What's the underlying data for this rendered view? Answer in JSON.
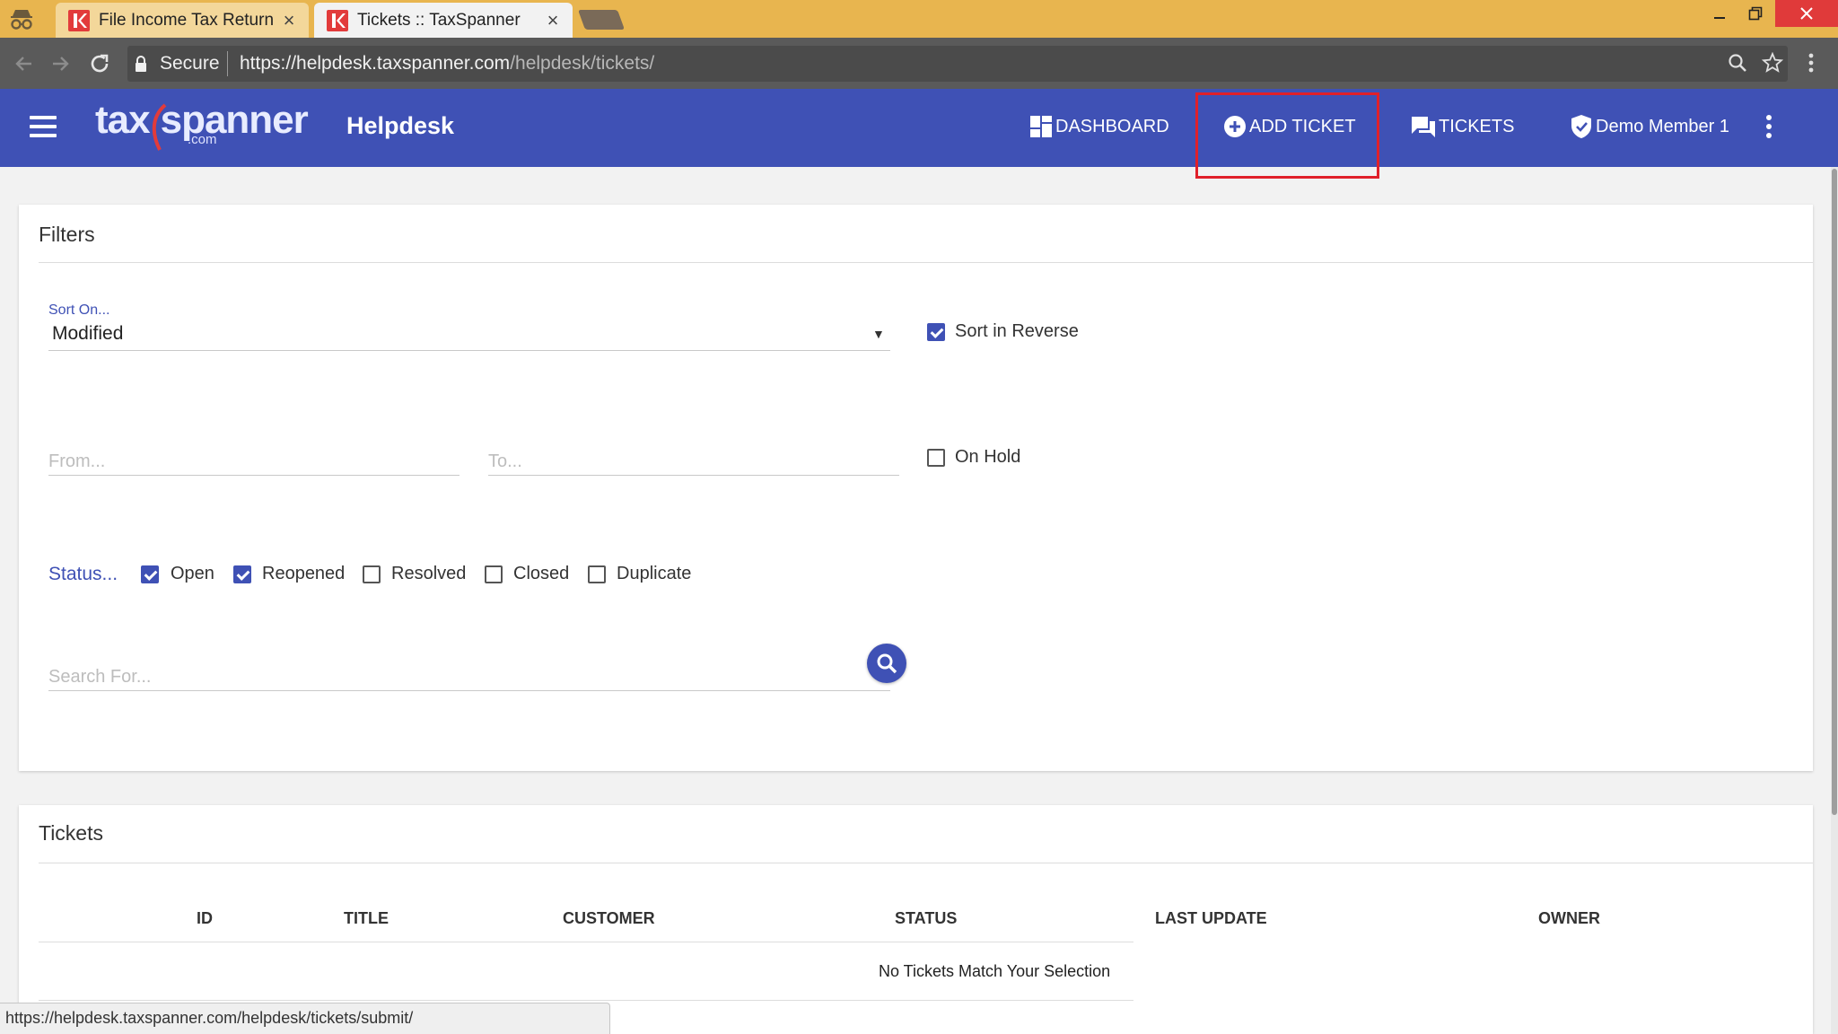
{
  "browser": {
    "tabs": [
      {
        "title": "File Income Tax Return C",
        "close": "×",
        "active": false
      },
      {
        "title": "Tickets :: TaxSpanner",
        "close": "×",
        "active": true
      }
    ],
    "address": {
      "secure_label": "Secure",
      "url_host": "https://helpdesk.taxspanner.com",
      "url_path": "/helpdesk/tickets/"
    },
    "status_url": "https://helpdesk.taxspanner.com/helpdesk/tickets/submit/"
  },
  "header": {
    "logo_text_left": "tax",
    "logo_text_right": "spanner",
    "logo_suffix": ".com",
    "app_title": "Helpdesk",
    "nav": {
      "dashboard": "DASHBOARD",
      "add_ticket": "ADD TICKET",
      "tickets": "TICKETS",
      "user": "Demo Member 1"
    }
  },
  "filters": {
    "title": "Filters",
    "sort_label": "Sort On...",
    "sort_value": "Modified",
    "sort_reverse_label": "Sort in Reverse",
    "sort_reverse_checked": true,
    "from_placeholder": "From...",
    "to_placeholder": "To...",
    "on_hold_label": "On Hold",
    "on_hold_checked": false,
    "status_label": "Status...",
    "statuses": [
      {
        "label": "Open",
        "checked": true
      },
      {
        "label": "Reopened",
        "checked": true
      },
      {
        "label": "Resolved",
        "checked": false
      },
      {
        "label": "Closed",
        "checked": false
      },
      {
        "label": "Duplicate",
        "checked": false
      }
    ],
    "search_placeholder": "Search For..."
  },
  "tickets": {
    "title": "Tickets",
    "columns": [
      "ID",
      "TITLE",
      "CUSTOMER",
      "STATUS",
      "LAST UPDATE",
      "OWNER"
    ],
    "empty_message": "No Tickets Match Your Selection"
  },
  "colors": {
    "primary": "#3f51b5",
    "tab_bar": "#e8b54f",
    "highlight": "#e0202a"
  }
}
